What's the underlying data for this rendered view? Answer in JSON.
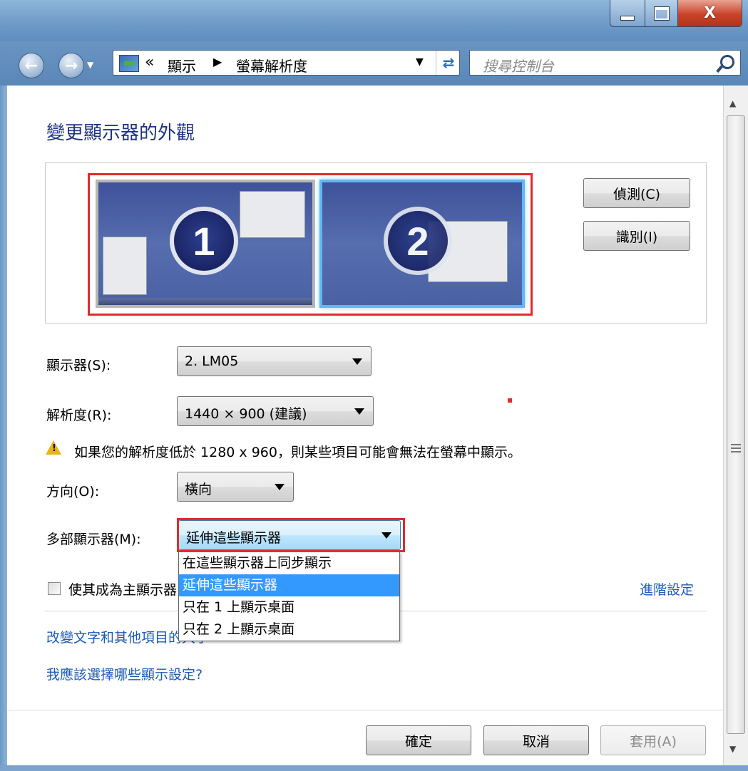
{
  "window": {
    "close_glyph": "X"
  },
  "nav": {
    "breadcrumb_chevron": "«",
    "breadcrumb": [
      "顯示",
      "螢幕解析度"
    ],
    "breadcrumb_sep": "▶",
    "search_placeholder": "搜尋控制台"
  },
  "page": {
    "heading": "變更顯示器的外觀",
    "monitors": [
      "1",
      "2"
    ],
    "detect_button": "偵測(C)",
    "identify_button": "識別(I)",
    "display_label": "顯示器(S):",
    "display_value": "2. LM05",
    "resolution_label": "解析度(R):",
    "resolution_value": "1440 × 900 (建議)",
    "warning_text": "如果您的解析度低於 1280 x 960，則某些項目可能會無法在螢幕中顯示。",
    "orientation_label": "方向(O):",
    "orientation_value": "橫向",
    "multi_label": "多部顯示器(M):",
    "multi_value": "延伸這些顯示器",
    "multi_options": [
      "在這些顯示器上同步顯示",
      "延伸這些顯示器",
      "只在 1 上顯示桌面",
      "只在 2 上顯示桌面"
    ],
    "multi_selected_index": 1,
    "main_display_checkbox": "使其成為主顯示器",
    "advanced_link": "進階設定",
    "text_size_link": "改變文字和其他項目的大小",
    "which_settings_link": "我應該選擇哪些顯示設定?"
  },
  "footer": {
    "ok": "確定",
    "cancel": "取消",
    "apply": "套用(A)"
  },
  "colors": {
    "link": "#1c5bb8",
    "heading": "#1e3287",
    "highlight": "#e22a2a",
    "selected": "#3399ff"
  }
}
